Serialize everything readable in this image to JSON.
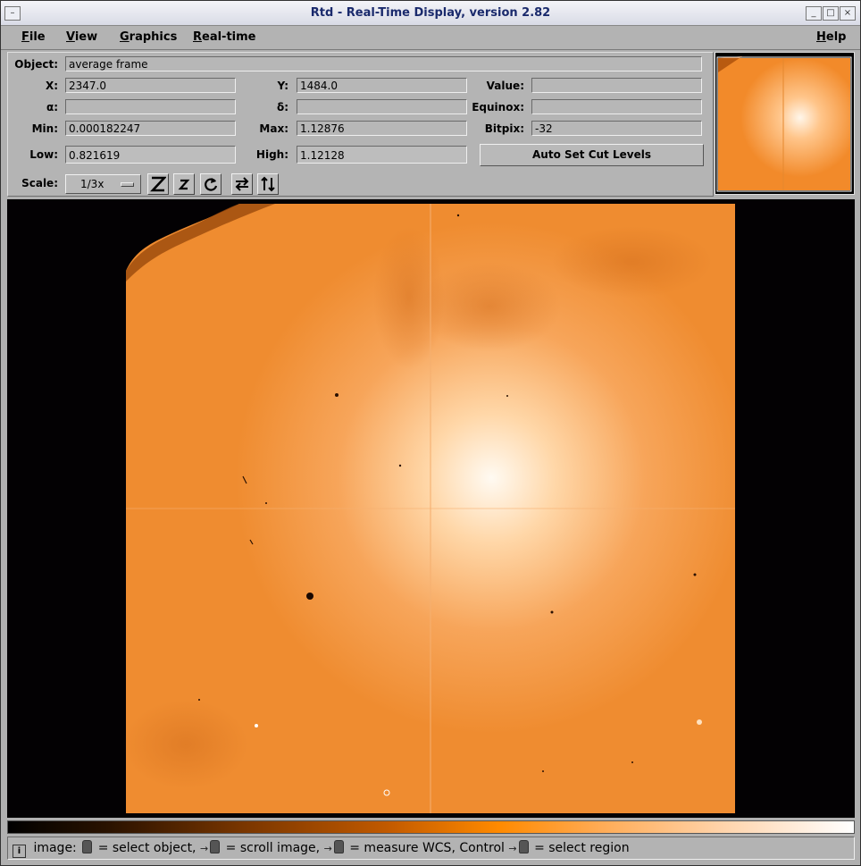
{
  "window": {
    "title": "Rtd - Real-Time Display, version 2.82",
    "buttons": {
      "menu": "–",
      "minimize": "_",
      "maximize": "□",
      "close": "×"
    }
  },
  "menubar": {
    "items": [
      {
        "label": "File",
        "mnemonic": "F",
        "rest": "ile"
      },
      {
        "label": "View",
        "mnemonic": "V",
        "rest": "iew"
      },
      {
        "label": "Graphics",
        "mnemonic": "G",
        "rest": "raphics"
      },
      {
        "label": "Real-time",
        "mnemonic": "R",
        "rest": "eal-time"
      }
    ],
    "help": {
      "label": "Help",
      "mnemonic": "H",
      "rest": "elp"
    }
  },
  "info": {
    "object_label": "Object:",
    "object_value": "average frame",
    "x_label": "X:",
    "x_value": "2347.0",
    "y_label": "Y:",
    "y_value": "1484.0",
    "value_label": "Value:",
    "value_value": "",
    "alpha_label": "α:",
    "alpha_value": "",
    "delta_label": "δ:",
    "delta_value": "",
    "equinox_label": "Equinox:",
    "equinox_value": "",
    "min_label": "Min:",
    "min_value": "0.000182247",
    "max_label": "Max:",
    "max_value": "1.12876",
    "bitpix_label": "Bitpix:",
    "bitpix_value": "-32",
    "low_label": "Low:",
    "low_value": "0.821619",
    "high_label": "High:",
    "high_value": "1.12128",
    "auto_cut_label": "Auto Set Cut Levels",
    "scale_label": "Scale:",
    "scale_value": "1/3x"
  },
  "toolbar_icons": [
    "zoom-in-icon",
    "zoom-out-icon",
    "rotate-icon",
    "flip-x-icon",
    "flip-y-icon"
  ],
  "colorbar": {
    "colormap": [
      "#000000",
      "#ff8a00",
      "#ffffff"
    ]
  },
  "status": {
    "prefix": "image:",
    "part1": "= select object,",
    "part2": "= scroll image,",
    "part3": "= measure WCS, Control",
    "part4": "= select region"
  },
  "colors": {
    "image_orange": "#f08a2a",
    "image_highlight": "#fff8ee",
    "background": "#030103"
  }
}
